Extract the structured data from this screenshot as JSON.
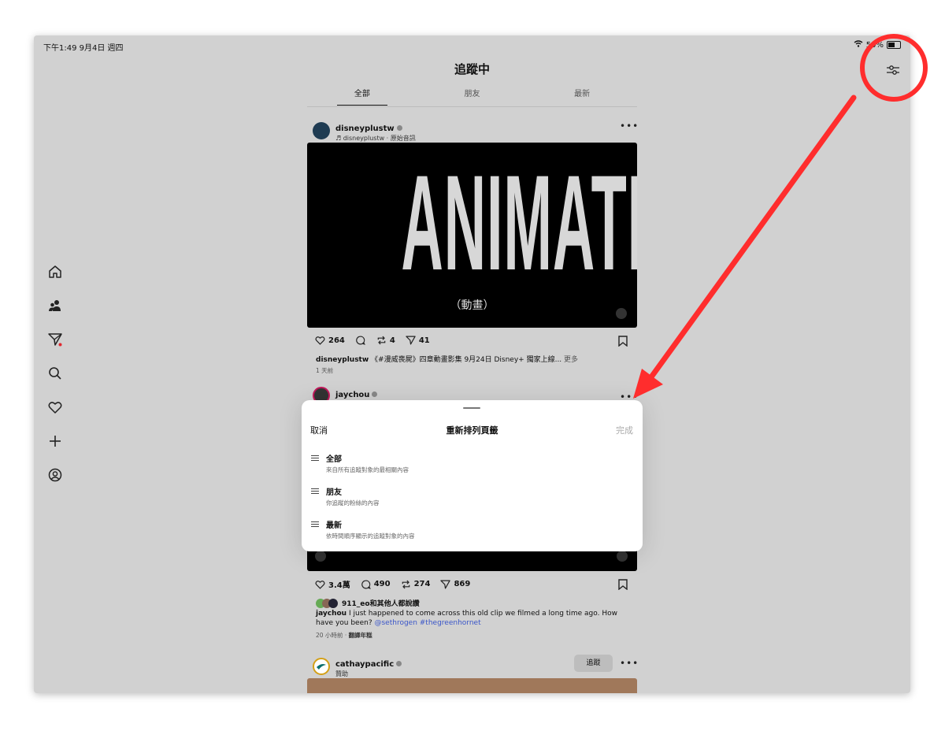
{
  "status": {
    "time": "下午1:49 9月4日 週四",
    "battery": "50%"
  },
  "header": {
    "title": "追蹤中"
  },
  "tabs": [
    {
      "label": "全部",
      "active": true
    },
    {
      "label": "朋友",
      "active": false
    },
    {
      "label": "最新",
      "active": false
    }
  ],
  "post1": {
    "username": "disneyplustw",
    "audio": "♬ disneyplustw · 原始音訊",
    "media_title": "ANIMATION",
    "media_subtitle": "（動畫）",
    "likes": "264",
    "reposts": "4",
    "shares": "41",
    "caption_user": "disneyplustw",
    "caption_text": "《#漫威喪屍》四章動畫影集 9月24日 Disney+ 獨家上線...",
    "caption_more": "更多",
    "time": "1 天前"
  },
  "post2": {
    "username": "jaychou",
    "likes": "3.4萬",
    "comments": "490",
    "reposts": "274",
    "shares": "869",
    "liked_by": "911_eo和其他人都說讚",
    "caption_user": "jaychou",
    "caption_text": "I just happened to come across this old clip we filmed a long time ago. How have you been?",
    "caption_links": "@sethrogen #thegreenhornet",
    "time": "20 小時前",
    "translate": "翻譯年糕"
  },
  "post3": {
    "username": "cathaypacific",
    "sponsored": "贊助",
    "follow_label": "追蹤"
  },
  "sheet": {
    "cancel": "取消",
    "title": "重新排列頁籤",
    "done": "完成",
    "items": [
      {
        "label": "全部",
        "desc": "來自所有追蹤對象的最相關內容"
      },
      {
        "label": "朋友",
        "desc": "你追蹤的粉絲的內容"
      },
      {
        "label": "最新",
        "desc": "依時間順序顯示的追蹤對象的內容"
      }
    ]
  },
  "annotation": {
    "color": "#ff2d2d"
  }
}
